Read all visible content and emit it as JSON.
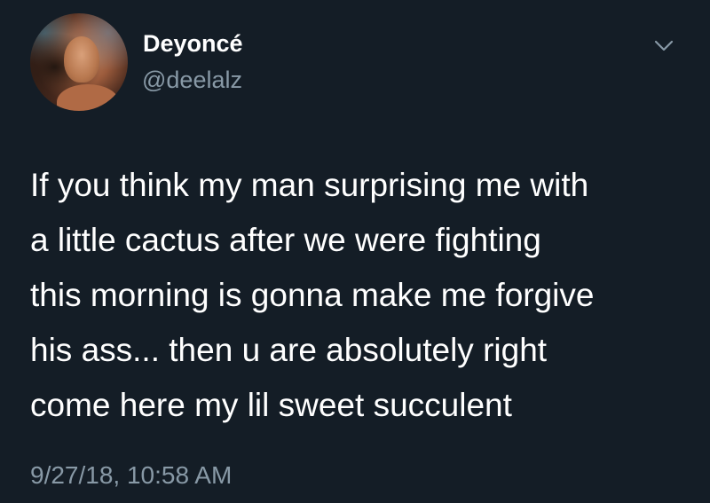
{
  "tweet": {
    "author": {
      "display_name": "Deyoncé",
      "handle": "@deelalz",
      "avatar_icon": "profile-photo"
    },
    "menu_icon": "chevron-down-icon",
    "text_lines": [
      "If you think my man surprising me with",
      "a little cactus after we were fighting",
      "this morning is gonna make me forgive",
      "his ass... then u are absolutely right",
      "come here my lil sweet succulent"
    ],
    "timestamp": "9/27/18, 10:58 AM"
  },
  "colors": {
    "background": "#141d26",
    "text": "#ffffff",
    "secondary_text": "#8899a6"
  }
}
